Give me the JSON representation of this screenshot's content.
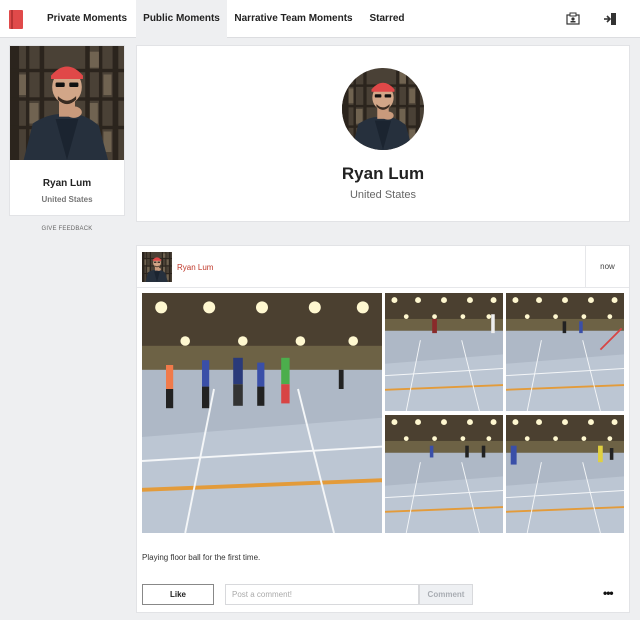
{
  "nav": {
    "tabs": [
      {
        "label": "Private Moments"
      },
      {
        "label": "Public Moments"
      },
      {
        "label": "Narrative Team Moments"
      },
      {
        "label": "Starred"
      }
    ]
  },
  "profile": {
    "name": "Ryan Lum",
    "location": "United States",
    "feedback_link": "GIVE FEEDBACK"
  },
  "post": {
    "author": "Ryan Lum",
    "time": "now",
    "caption": "Playing floor ball for the first time.",
    "like_label": "Like",
    "comment_placeholder": "Post a comment!",
    "comment_label": "Comment",
    "more_label": "•••"
  },
  "colors": {
    "accent": "#c0392b",
    "brand": "#e04a4a",
    "background": "#eeeff1"
  }
}
